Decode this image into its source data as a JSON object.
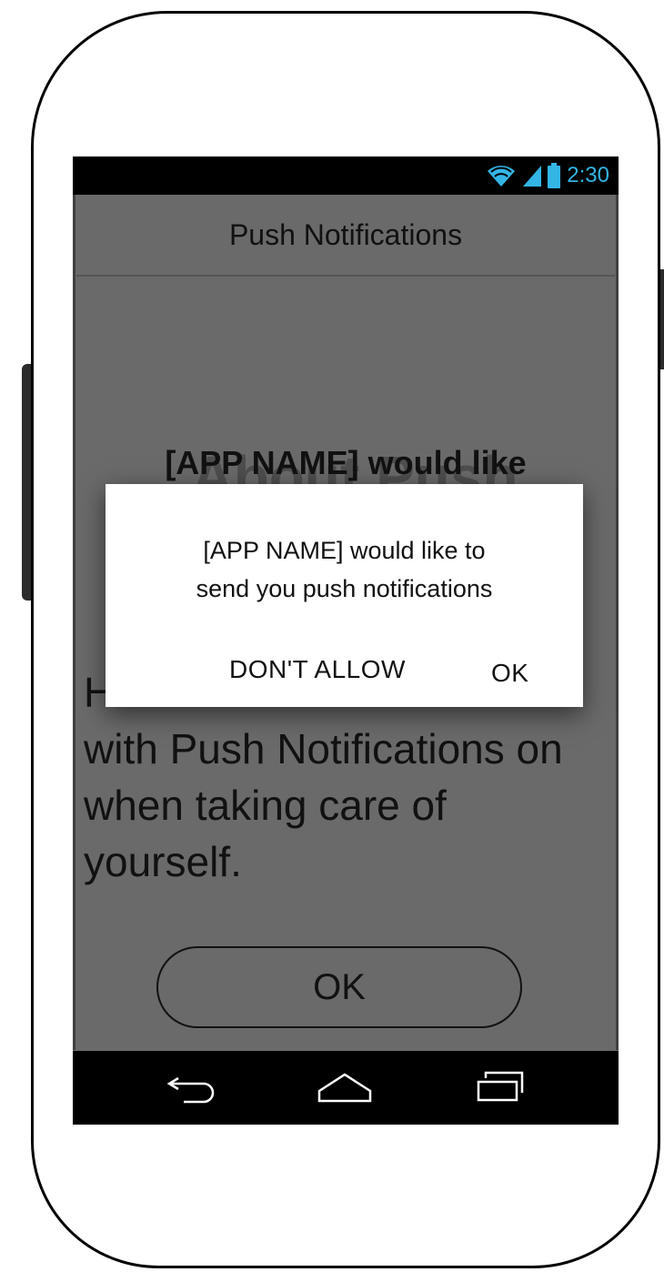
{
  "status_bar": {
    "time": "2:30",
    "accent_color": "#33b5e5",
    "icons": [
      "wifi-icon",
      "signal-icon",
      "battery-icon"
    ]
  },
  "header": {
    "title": "Push Notifications"
  },
  "content": {
    "ghost_heading": "About Push",
    "overlay_heading": "[APP NAME] would like",
    "body_prefix": "H",
    "body_lines": [
      "with Push Notifications on",
      "when taking care of",
      "yourself."
    ],
    "ok_button": "OK"
  },
  "dialog": {
    "message_line1": "[APP NAME] would like to",
    "message_line2": "send you push notifications",
    "dont_allow_label": "DON'T ALLOW",
    "ok_label": "OK"
  },
  "nav_bar": {
    "icons": [
      "back-icon",
      "home-icon",
      "recents-icon"
    ]
  }
}
